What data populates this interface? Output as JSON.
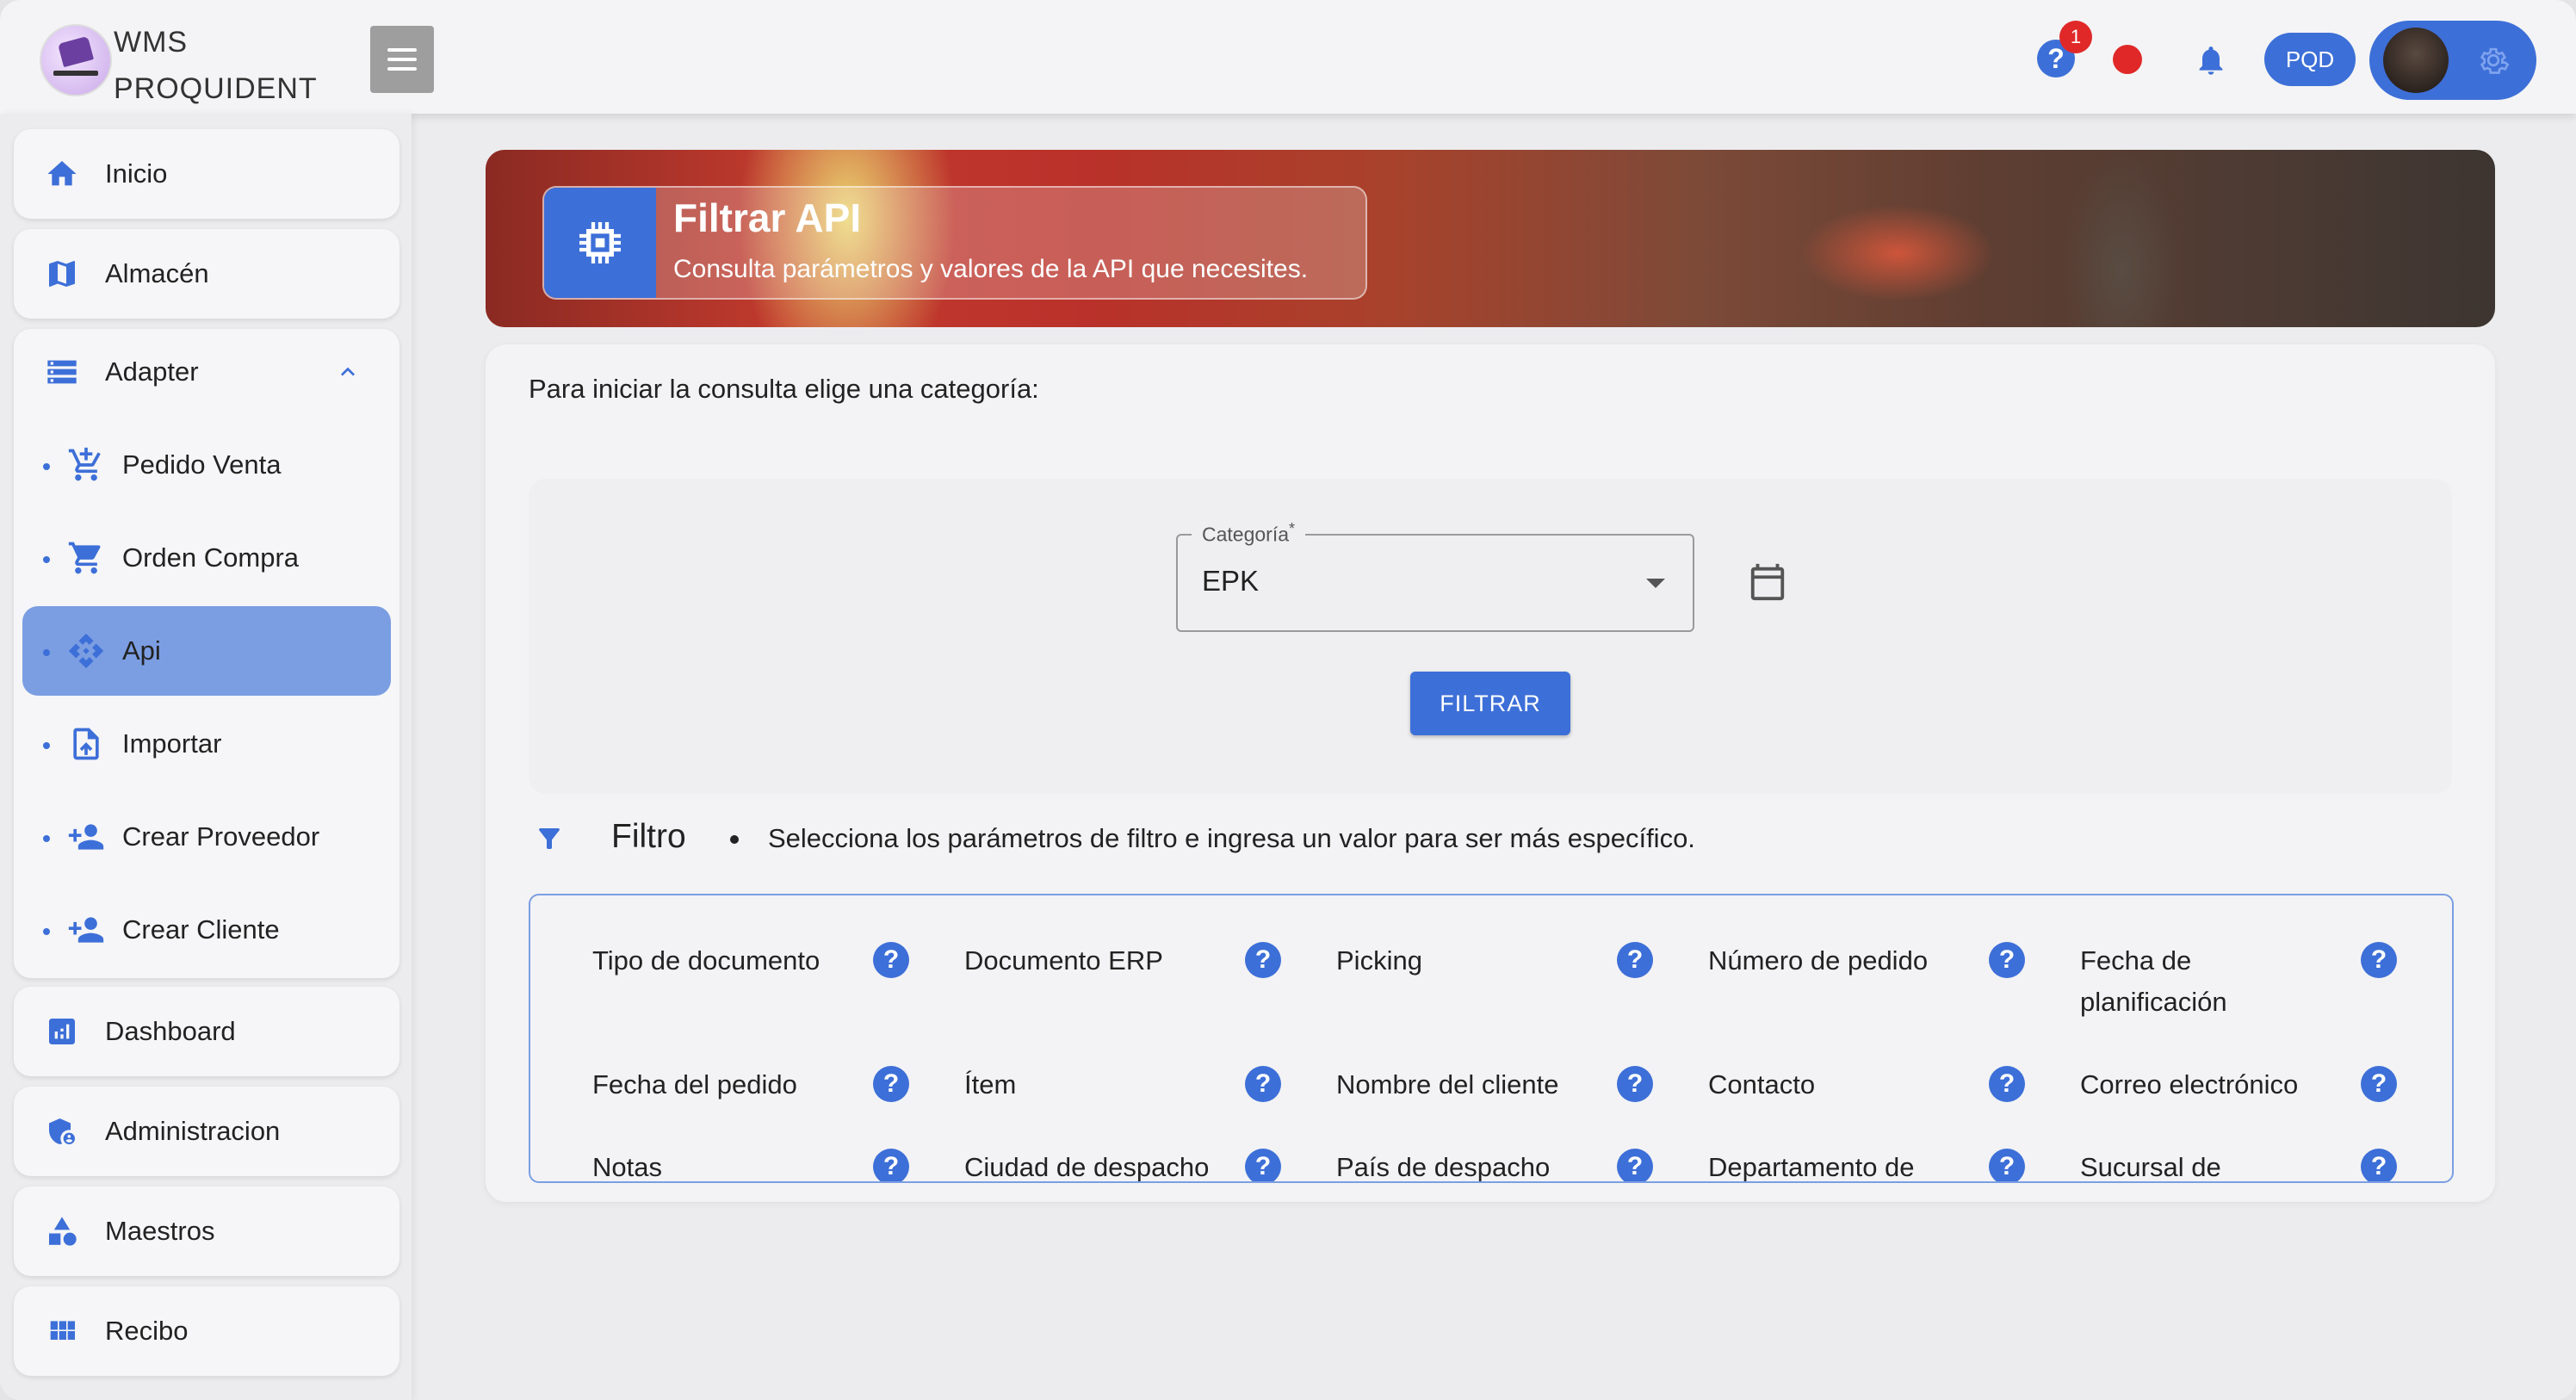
{
  "header": {
    "brand_line1": "WMS",
    "brand_line2": "PROQUIDENT",
    "help_badge_count": "1",
    "user_code": "PQD"
  },
  "sidebar": {
    "items": [
      {
        "label": "Inicio",
        "icon": "home-icon"
      },
      {
        "label": "Almacén",
        "icon": "map-icon"
      },
      {
        "label": "Adapter",
        "icon": "storage-icon",
        "expanded": true
      },
      {
        "label": "Dashboard",
        "icon": "bar-chart-icon"
      },
      {
        "label": "Administracion",
        "icon": "admin-shield-icon"
      },
      {
        "label": "Maestros",
        "icon": "shapes-icon"
      },
      {
        "label": "Recibo",
        "icon": "grid-icon"
      }
    ],
    "adapter_sub": [
      {
        "label": "Pedido Venta",
        "icon": "cart-add-icon"
      },
      {
        "label": "Orden Compra",
        "icon": "cart-icon"
      },
      {
        "label": "Api",
        "icon": "api-icon",
        "active": true
      },
      {
        "label": "Importar",
        "icon": "upload-file-icon"
      },
      {
        "label": "Crear Proveedor",
        "icon": "person-add-icon"
      },
      {
        "label": "Crear Cliente",
        "icon": "person-add-icon"
      }
    ]
  },
  "banner": {
    "title": "Filtrar API",
    "subtitle": "Consulta parámetros y valores de la API que necesites."
  },
  "main": {
    "intro": "Para iniciar la consulta elige una categoría:",
    "category_label": "Categoría",
    "category_required": "*",
    "category_value": "EPK",
    "filter_button": "FILTRAR",
    "filtro_title": "Filtro",
    "filtro_desc": "Selecciona los parámetros de filtro e ingresa un valor para ser más específico.",
    "params": [
      "Tipo de documento",
      "Documento ERP",
      "Picking",
      "Número de pedido",
      "Fecha de planificación",
      "Fecha del pedido",
      "Ítem",
      "Nombre del cliente",
      "Contacto",
      "Correo electrónico",
      "Notas",
      "Ciudad de despacho",
      "País de despacho",
      "Departamento de",
      "Sucursal de despacho"
    ]
  },
  "colors": {
    "accent": "#3d6fd8",
    "active_nav": "#7b9ee2",
    "alert": "#e02828"
  }
}
